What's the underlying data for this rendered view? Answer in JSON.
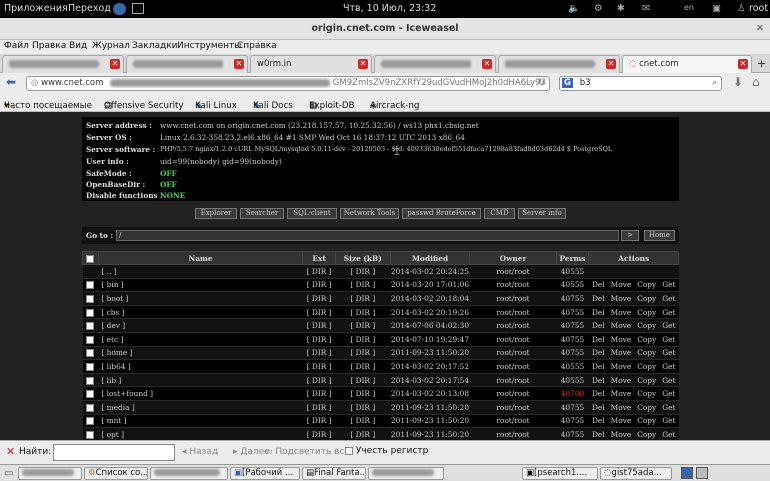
{
  "topbar": {
    "apps": "Приложения",
    "places": "Переход",
    "clock": "Чтв, 10 Июл, 23:32",
    "lang": "en",
    "user": "root"
  },
  "window": {
    "title": "origin.cnet.com - Iceweasel"
  },
  "menu": [
    "Файл",
    "Правка",
    "Вид",
    "Журнал",
    "Закладки",
    "Инструменты",
    "Справка"
  ],
  "tabs": [
    {
      "label": ""
    },
    {
      "label": ""
    },
    {
      "label": "w0rm.in"
    },
    {
      "label": ""
    },
    {
      "label": ""
    },
    {
      "label": "cnet.com"
    }
  ],
  "nav": {
    "url_host": "www.cnet.com",
    "url_tail": "GM9ZmlsZV9nZXRfY29udGVudHMoJ2h0dHA6Ly93",
    "search_engine": "G",
    "search_value": "b3"
  },
  "bookmarks": [
    "Часто посещаемые",
    "Offensive Security",
    "Kali Linux",
    "Kali Docs",
    "Exploit-DB",
    "Aircrack-ng"
  ],
  "info": {
    "rows": [
      {
        "key": "Server address :",
        "value": "www.cnet.com on origin.cnet.com (23.218.157.57, 10.25.32.56) / ws13 phx1.cbsig.net"
      },
      {
        "key": "Server OS :",
        "value": "Linux 2.6.32-358.23.2.el6.x86_64 #1 SMP Wed Oct 16 18:37:12 UTC 2013 x86_64"
      },
      {
        "key": "Server software :",
        "value": "PHP/5.5.7 nginx/1.2.0 cURL MySQL/mysqlnd 5.0.11-dev - 20120503 - $Id: 40933630edef551dfaca71298a83fad8d03d62d4 $ PostgreSQL"
      },
      {
        "key": "User info :",
        "value": "uid=99(nobody) gid=99(nobody)"
      },
      {
        "key": "SafeMode :",
        "value": "OFF"
      },
      {
        "key": "OpenBaseDir :",
        "value": "OFF"
      },
      {
        "key": "Disable functions :",
        "value": "NONE"
      }
    ]
  },
  "buttons": [
    "Explorer",
    "Searcher",
    "SQL-client",
    "Network Tools",
    "passwd BruteForce",
    "CMD",
    "Server info"
  ],
  "goto": {
    "label": "Go to :",
    "value": "/",
    "go": ">",
    "home": "Home"
  },
  "table": {
    "headers": [
      "",
      "Name",
      "Ext",
      "Size (kB)",
      "Modified",
      "Owner",
      "Perms",
      "Actions"
    ],
    "rows": [
      {
        "name": "[ .. ]",
        "ext": "[ DIR ]",
        "size": "[ DIR ]",
        "mod": "2014-03-02 20:24:25",
        "owner": "root/root",
        "perms": "40555",
        "checkbox": false,
        "actions": false,
        "red": false
      },
      {
        "name": "[ bin ]",
        "ext": "[ DIR ]",
        "size": "[ DIR ]",
        "mod": "2014-03-20 17:01:06",
        "owner": "root/root",
        "perms": "40555",
        "checkbox": true,
        "actions": true,
        "red": false
      },
      {
        "name": "[ boot ]",
        "ext": "[ DIR ]",
        "size": "[ DIR ]",
        "mod": "2014-03-02 20:18:04",
        "owner": "root/root",
        "perms": "40755",
        "checkbox": true,
        "actions": true,
        "red": false
      },
      {
        "name": "[ cbs ]",
        "ext": "[ DIR ]",
        "size": "[ DIR ]",
        "mod": "2014-03-02 20:19:26",
        "owner": "root/root",
        "perms": "40755",
        "checkbox": true,
        "actions": true,
        "red": false
      },
      {
        "name": "[ dev ]",
        "ext": "[ DIR ]",
        "size": "[ DIR ]",
        "mod": "2014-07-06 04:02:30",
        "owner": "root/root",
        "perms": "40755",
        "checkbox": true,
        "actions": true,
        "red": false
      },
      {
        "name": "[ etc ]",
        "ext": "[ DIR ]",
        "size": "[ DIR ]",
        "mod": "2014-07-10 19:29:47",
        "owner": "root/root",
        "perms": "40755",
        "checkbox": true,
        "actions": true,
        "red": false
      },
      {
        "name": "[ home ]",
        "ext": "[ DIR ]",
        "size": "[ DIR ]",
        "mod": "2011-09-23 11:50:20",
        "owner": "root/root",
        "perms": "40755",
        "checkbox": true,
        "actions": true,
        "red": false
      },
      {
        "name": "[ lib64 ]",
        "ext": "[ DIR ]",
        "size": "[ DIR ]",
        "mod": "2014-03-02 20:17:52",
        "owner": "root/root",
        "perms": "40555",
        "checkbox": true,
        "actions": true,
        "red": false
      },
      {
        "name": "[ lib ]",
        "ext": "[ DIR ]",
        "size": "[ DIR ]",
        "mod": "2014-03-02 20:17:54",
        "owner": "root/root",
        "perms": "40555",
        "checkbox": true,
        "actions": true,
        "red": false
      },
      {
        "name": "[ lost+found ]",
        "ext": "[ DIR ]",
        "size": "[ DIR ]",
        "mod": "2014-03-02 20:13:08",
        "owner": "root/root",
        "perms": "40700",
        "checkbox": true,
        "actions": true,
        "red": true
      },
      {
        "name": "[ media ]",
        "ext": "[ DIR ]",
        "size": "[ DIR ]",
        "mod": "2011-09-23 11:50:20",
        "owner": "root/root",
        "perms": "40755",
        "checkbox": true,
        "actions": true,
        "red": false
      },
      {
        "name": "[ mnt ]",
        "ext": "[ DIR ]",
        "size": "[ DIR ]",
        "mod": "2011-09-23 11:50:20",
        "owner": "root/root",
        "perms": "40755",
        "checkbox": true,
        "actions": true,
        "red": false
      },
      {
        "name": "[ opt ]",
        "ext": "[ DIR ]",
        "size": "[ DIR ]",
        "mod": "2011-09-23 11:50:20",
        "owner": "root/root",
        "perms": "40755",
        "checkbox": true,
        "actions": true,
        "red": false
      }
    ],
    "actions": [
      "Del",
      "Move",
      "Copy",
      "Get"
    ]
  },
  "findbar": {
    "label": "Найти:",
    "back": "Назад",
    "next": "Далее",
    "highlight": "Подсветить все",
    "case": "Учесть регистр"
  },
  "taskbar": [
    {
      "label": ""
    },
    {
      "label": "Список со..."
    },
    {
      "label": ""
    },
    {
      "label": "[Рабочий ..."
    },
    {
      "label": "Final Fanta..."
    },
    {
      "label": ""
    },
    {
      "label": "[psearch1...."
    },
    {
      "label": "gist75ada..."
    }
  ]
}
